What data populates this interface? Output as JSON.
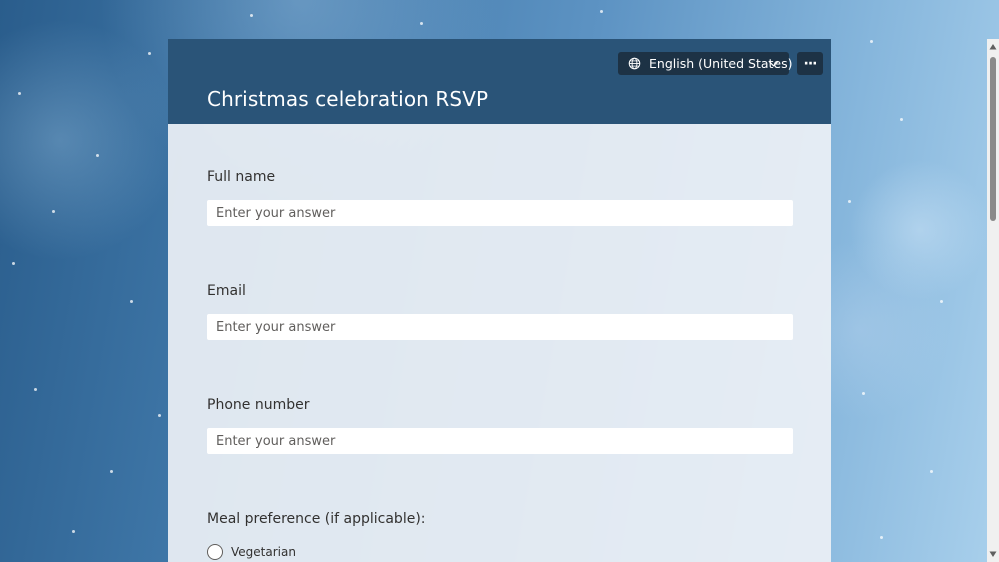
{
  "form": {
    "title": "Christmas celebration RSVP",
    "language": {
      "selected": "English (United States)",
      "icon": "globe-icon",
      "chevron_icon": "chevron-down-icon"
    },
    "more_options": {
      "label": "···",
      "icon": "more-horizontal-icon"
    },
    "questions": [
      {
        "label": "Full name",
        "placeholder": "Enter your answer"
      },
      {
        "label": "Email",
        "placeholder": "Enter your answer"
      },
      {
        "label": "Phone number",
        "placeholder": "Enter your answer"
      }
    ],
    "meal": {
      "label": "Meal preference (if applicable):",
      "options": [
        "Vegetarian"
      ]
    }
  },
  "colors": {
    "header_bg": "#2a5478",
    "control_bg": "#1d3245",
    "card_bg": "#ecf0f5"
  }
}
